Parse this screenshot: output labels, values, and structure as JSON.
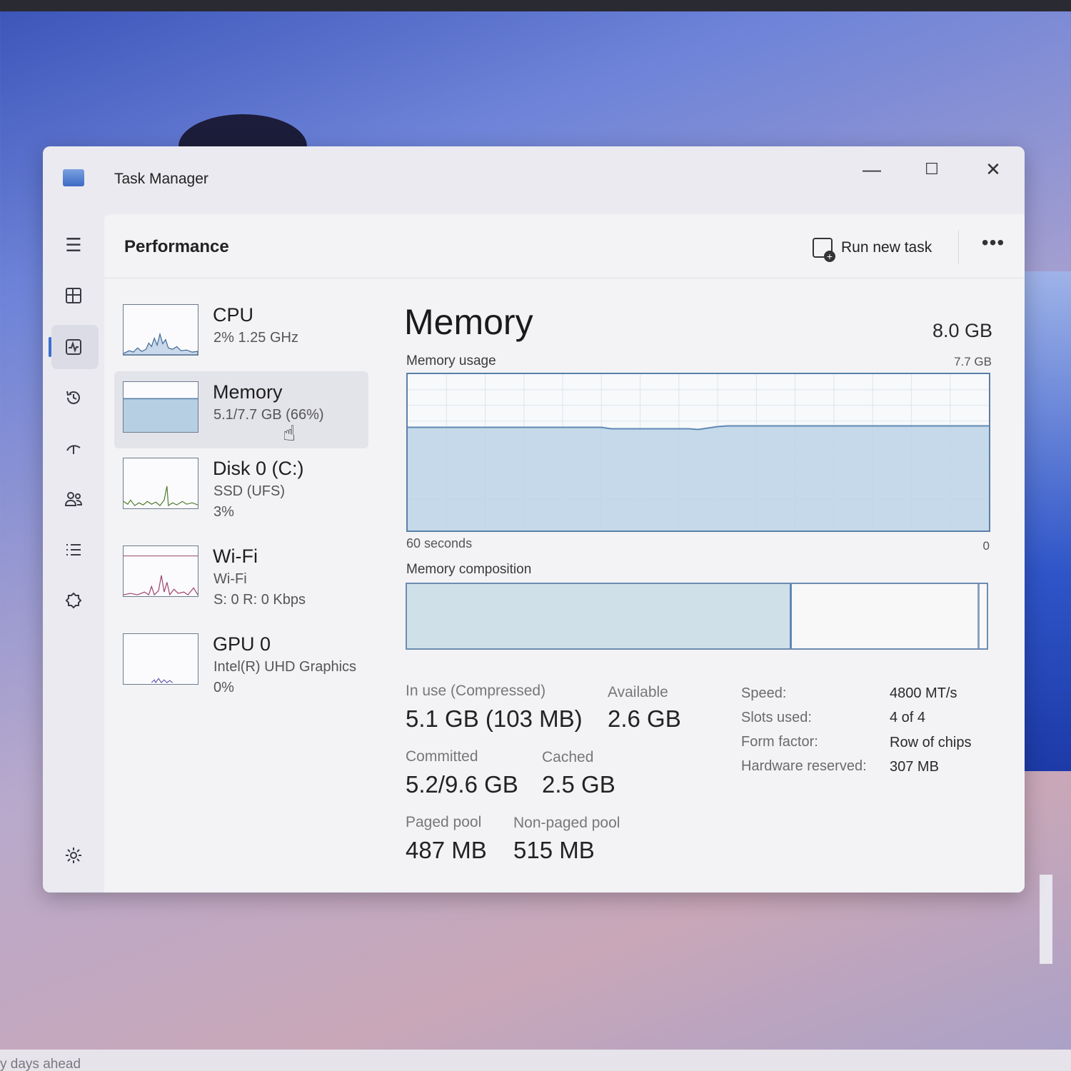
{
  "window": {
    "title": "Task Manager"
  },
  "titlebar": {
    "minimize": "—",
    "maximize": "☐",
    "close": "✕"
  },
  "header": {
    "page_title": "Performance",
    "run_new_task": "Run new task",
    "more": "•••"
  },
  "nav": [
    {
      "icon": "hamburger-menu-icon"
    },
    {
      "icon": "processes-icon"
    },
    {
      "icon": "performance-icon",
      "active": true
    },
    {
      "icon": "app-history-icon"
    },
    {
      "icon": "startup-apps-icon"
    },
    {
      "icon": "users-icon"
    },
    {
      "icon": "details-icon"
    },
    {
      "icon": "services-icon"
    },
    {
      "icon": "settings-icon"
    }
  ],
  "devices": [
    {
      "name": "CPU",
      "line1": "2%  1.25 GHz",
      "line2": ""
    },
    {
      "name": "Memory",
      "line1": "5.1/7.7 GB (66%)",
      "line2": "",
      "selected": true
    },
    {
      "name": "Disk 0 (C:)",
      "line1": "SSD (UFS)",
      "line2": "3%"
    },
    {
      "name": "Wi-Fi",
      "line1": "Wi-Fi",
      "line2": "S: 0  R: 0 Kbps"
    },
    {
      "name": "GPU 0",
      "line1": "Intel(R) UHD Graphics",
      "line2": "0%"
    }
  ],
  "memory": {
    "title": "Memory",
    "total": "8.0 GB",
    "usage_label": "Memory usage",
    "usage_max": "7.7 GB",
    "time_left": "60 seconds",
    "time_right": "0",
    "composition_label": "Memory composition",
    "usage_fraction": 0.66,
    "composition": {
      "in_use_fraction": 0.66,
      "reserved_fraction": 0.01
    },
    "stats": {
      "in_use_label": "In use (Compressed)",
      "in_use_value": "5.1 GB (103 MB)",
      "available_label": "Available",
      "available_value": "2.6 GB",
      "committed_label": "Committed",
      "committed_value": "5.2/9.6 GB",
      "cached_label": "Cached",
      "cached_value": "2.5 GB",
      "paged_label": "Paged pool",
      "paged_value": "487 MB",
      "nonpaged_label": "Non-paged pool",
      "nonpaged_value": "515 MB"
    },
    "props": {
      "speed_label": "Speed:",
      "speed_value": "4800 MT/s",
      "slots_label": "Slots used:",
      "slots_value": "4 of 4",
      "form_label": "Form factor:",
      "form_value": "Row of chips",
      "hw_label": "Hardware reserved:",
      "hw_value": "307 MB"
    }
  },
  "background": {
    "taskbar_snippet": "y days ahead"
  },
  "colors": {
    "accent": "#3b6fd1",
    "memory_fill": "#bcd4e6",
    "memory_line": "#5f89b4"
  }
}
